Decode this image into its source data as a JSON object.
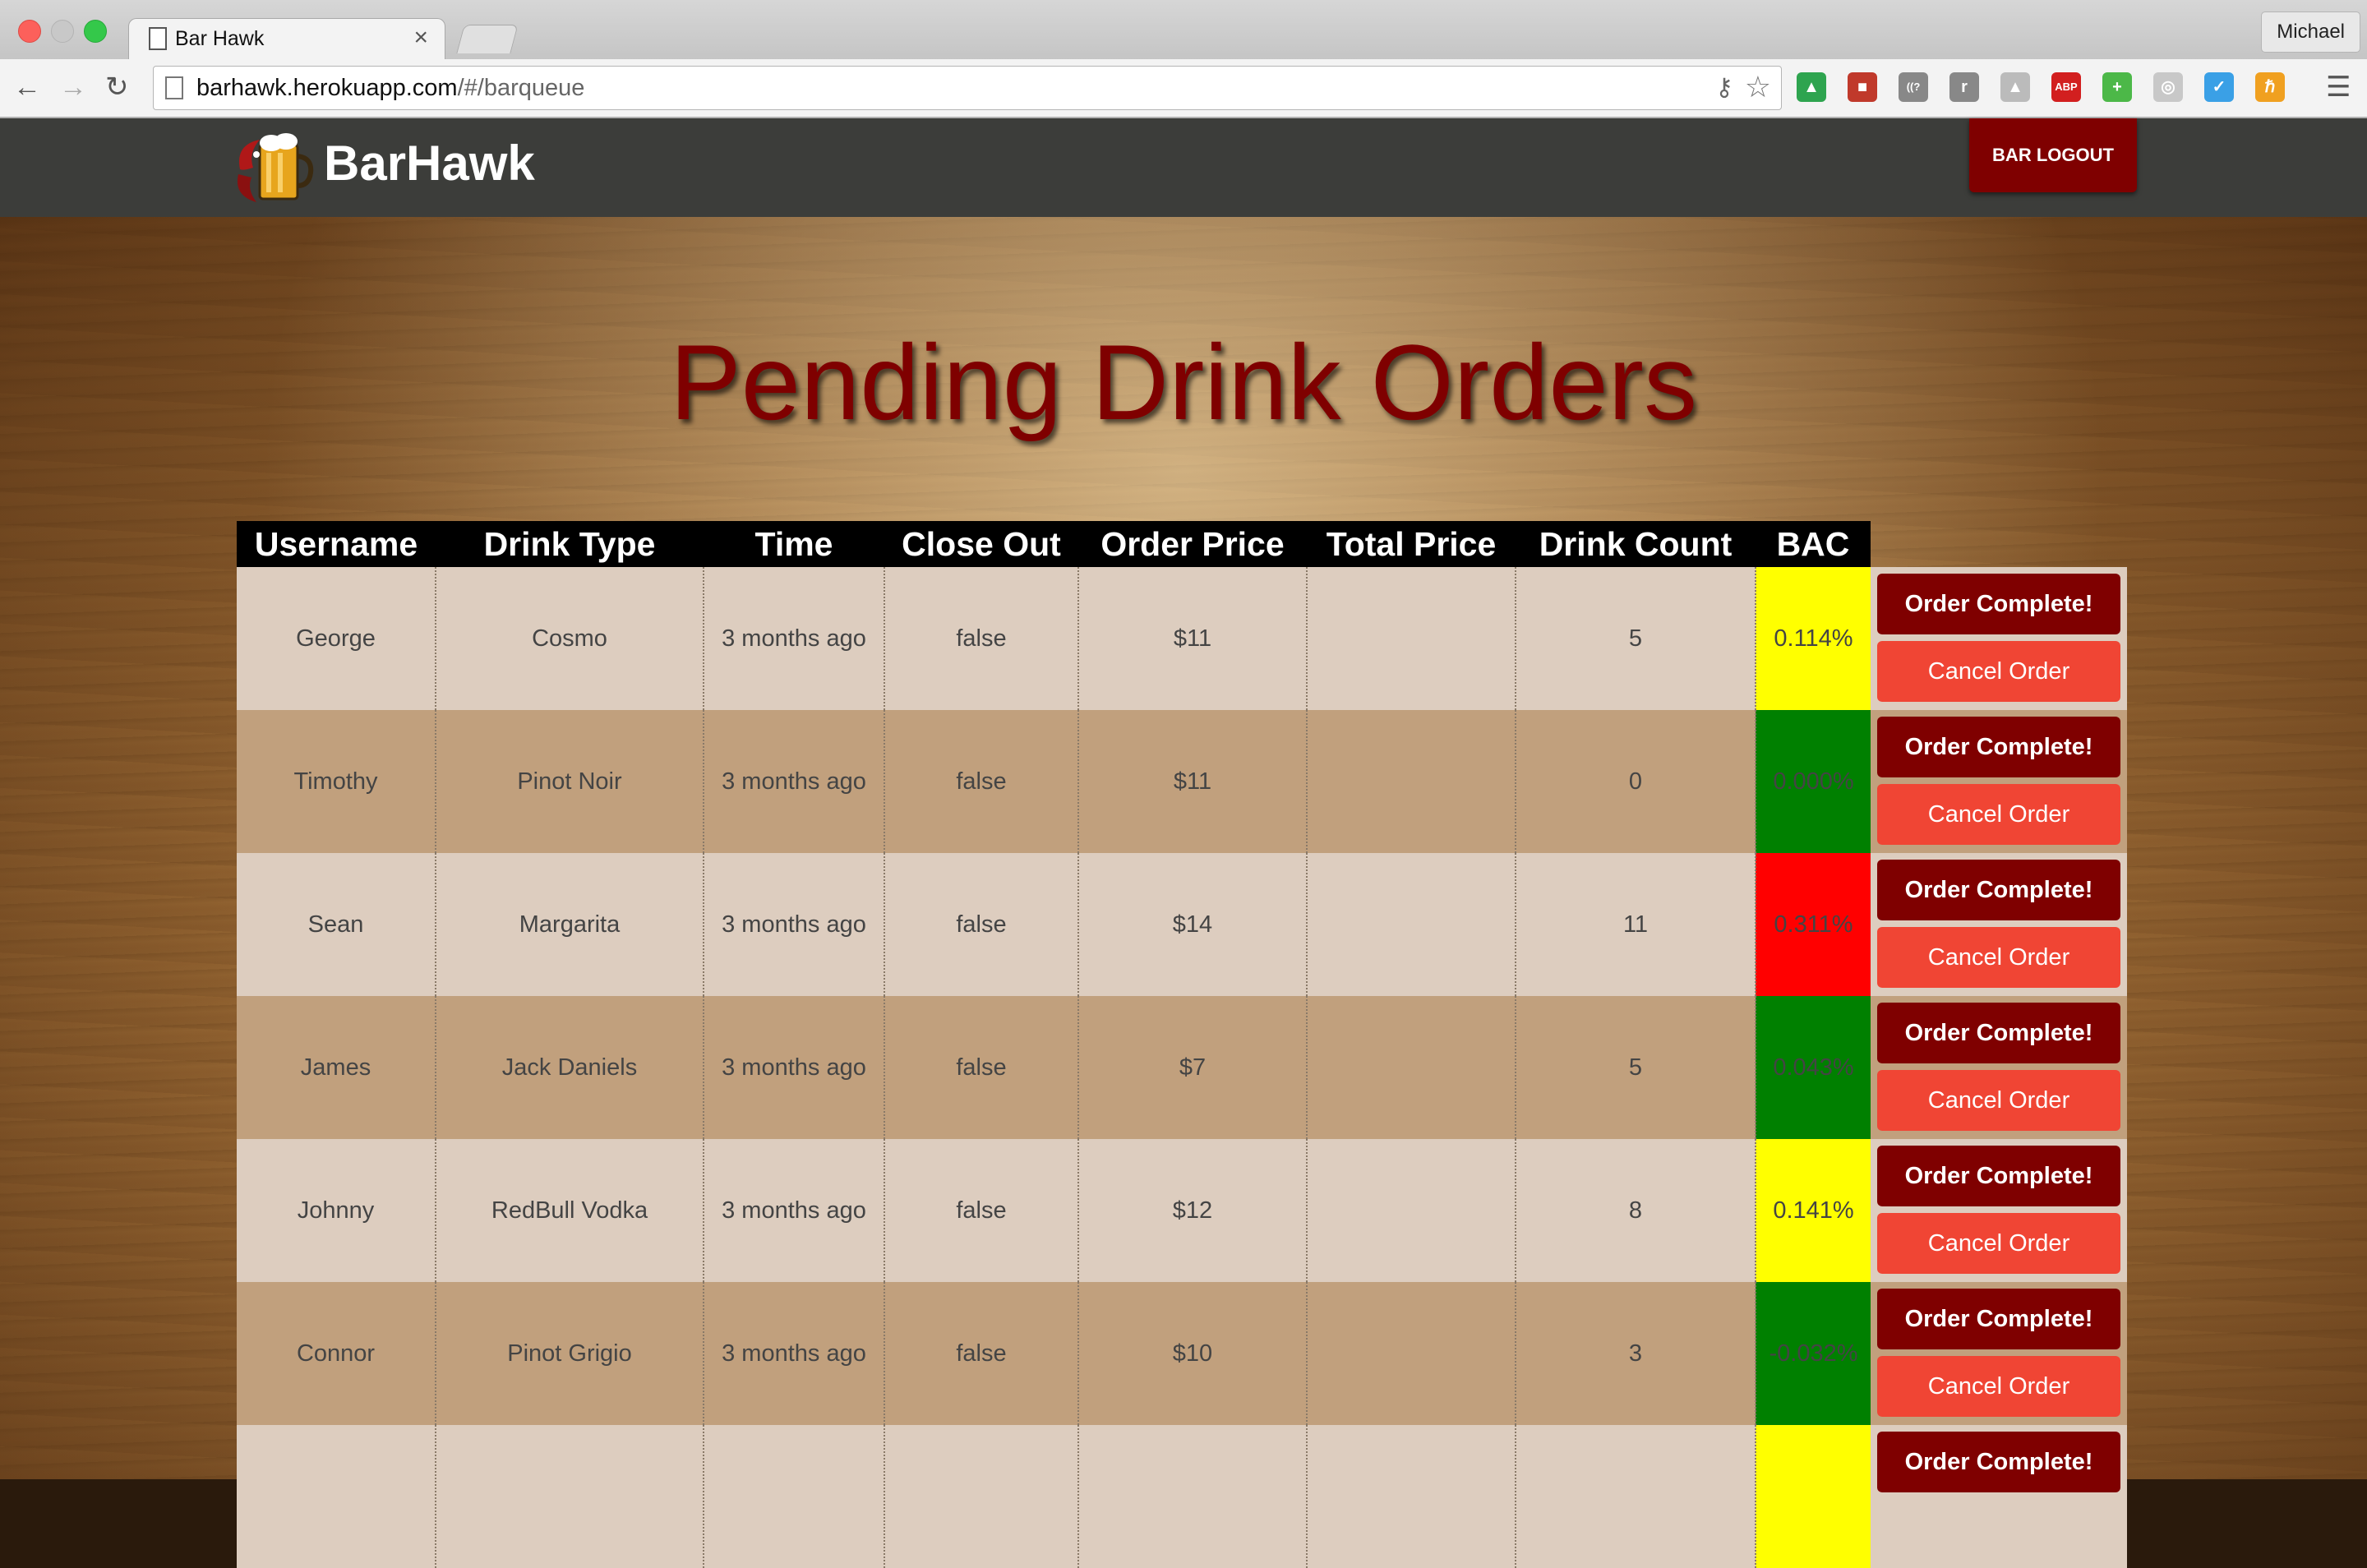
{
  "browser": {
    "tab_title": "Bar Hawk",
    "tab_close": "×",
    "profile_name": "Michael",
    "url_host": "barhawk.herokuapp.com",
    "url_path": "/#/barqueue",
    "extensions": [
      {
        "name": "google-drive-icon",
        "glyph": "▲",
        "color": "#2ea44f"
      },
      {
        "name": "bookmark-extension-icon",
        "glyph": "■",
        "color": "#c0392b"
      },
      {
        "name": "wireless-extension-icon",
        "glyph": "((?",
        "color": "#888888"
      },
      {
        "name": "readability-icon",
        "glyph": "r",
        "color": "#888888"
      },
      {
        "name": "drive-gray-icon",
        "glyph": "▲",
        "color": "#bbbbbb"
      },
      {
        "name": "adblock-plus-icon",
        "glyph": "ABP",
        "color": "#d21f1f"
      },
      {
        "name": "add-extension-icon",
        "glyph": "+",
        "color": "#4cb848"
      },
      {
        "name": "circle-extension-icon",
        "glyph": "◎",
        "color": "#c8c8c8"
      },
      {
        "name": "check-extension-icon",
        "glyph": "✓",
        "color": "#3aa0e6"
      },
      {
        "name": "hacker-news-icon",
        "glyph": "ℏ",
        "color": "#f0a020"
      }
    ]
  },
  "header": {
    "brand": "BarHawk",
    "logout_label": "BAR LOGOUT"
  },
  "page": {
    "title": "Pending Drink Orders"
  },
  "table": {
    "headers": [
      "Username",
      "Drink Type",
      "Time",
      "Close Out",
      "Order Price",
      "Total Price",
      "Drink Count",
      "BAC"
    ],
    "complete_label": "Order Complete!",
    "cancel_label": "Cancel Order",
    "rows": [
      {
        "username": "George",
        "drink": "Cosmo",
        "time": "3 months ago",
        "close_out": "false",
        "order_price": "$11",
        "total_price": "",
        "drink_count": "5",
        "bac": "0.114%",
        "bac_color": "#ffff00",
        "cancel": true
      },
      {
        "username": "Timothy",
        "drink": "Pinot Noir",
        "time": "3 months ago",
        "close_out": "false",
        "order_price": "$11",
        "total_price": "",
        "drink_count": "0",
        "bac": "0.000%",
        "bac_color": "#008000",
        "cancel": true
      },
      {
        "username": "Sean",
        "drink": "Margarita",
        "time": "3 months ago",
        "close_out": "false",
        "order_price": "$14",
        "total_price": "",
        "drink_count": "11",
        "bac": "0.311%",
        "bac_color": "#ff0000",
        "cancel": true
      },
      {
        "username": "James",
        "drink": "Jack Daniels",
        "time": "3 months ago",
        "close_out": "false",
        "order_price": "$7",
        "total_price": "",
        "drink_count": "5",
        "bac": "0.043%",
        "bac_color": "#008000",
        "cancel": true
      },
      {
        "username": "Johnny",
        "drink": "RedBull Vodka",
        "time": "3 months ago",
        "close_out": "false",
        "order_price": "$12",
        "total_price": "",
        "drink_count": "8",
        "bac": "0.141%",
        "bac_color": "#ffff00",
        "cancel": true
      },
      {
        "username": "Connor",
        "drink": "Pinot Grigio",
        "time": "3 months ago",
        "close_out": "false",
        "order_price": "$10",
        "total_price": "",
        "drink_count": "3",
        "bac": "-0.032%",
        "bac_color": "#008000",
        "cancel": true
      },
      {
        "username": "",
        "drink": "",
        "time": "",
        "close_out": "",
        "order_price": "",
        "total_price": "",
        "drink_count": "",
        "bac": "",
        "bac_color": "#ffff00",
        "cancel": false
      }
    ]
  }
}
